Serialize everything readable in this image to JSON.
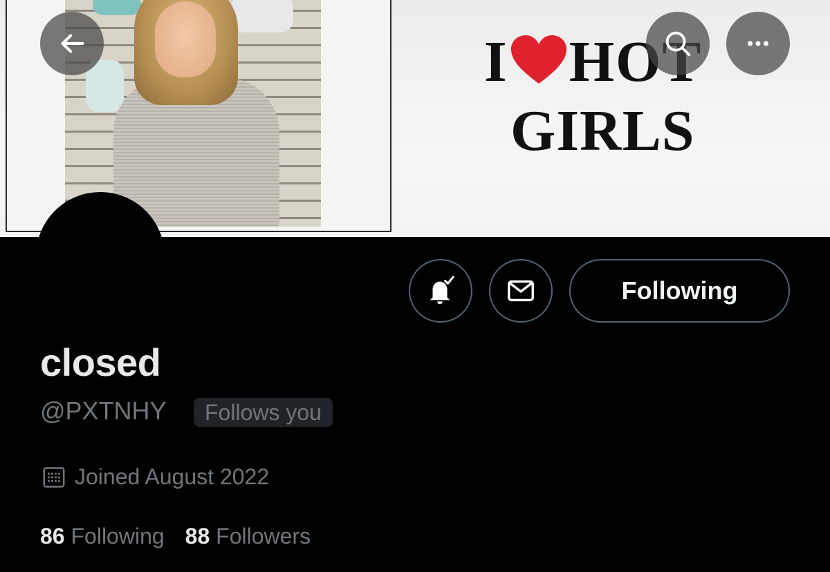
{
  "banner": {
    "text_line1_before": "I",
    "text_line1_after": "HOT",
    "text_line2": "GIRLS",
    "heart_color": "#e0222f"
  },
  "nav": {
    "back_icon": "arrow-left-icon",
    "search_icon": "search-icon",
    "more_icon": "more-dots-icon"
  },
  "actions": {
    "notifications_icon": "bell-check-icon",
    "message_icon": "envelope-icon",
    "follow_label": "Following"
  },
  "profile": {
    "display_name": "closed",
    "handle": "@PXTNHY",
    "follows_you": "Follows you",
    "joined": "Joined August 2022",
    "following_count": "86",
    "following_label": "Following",
    "followers_count": "88",
    "followers_label": "Followers"
  },
  "colors": {
    "background": "#000000",
    "primary_text": "#e7e9ea",
    "secondary_text": "#71767b",
    "border": "#536471"
  }
}
